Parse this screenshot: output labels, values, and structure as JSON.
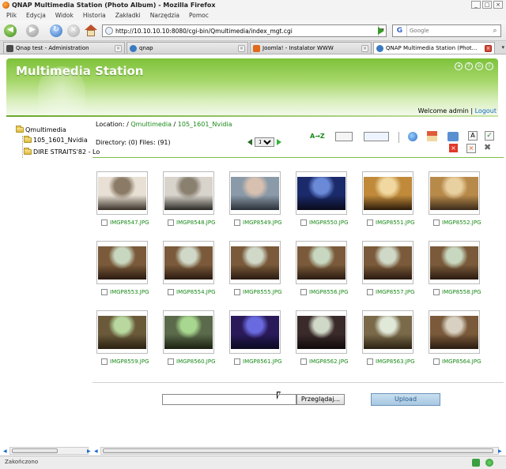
{
  "window": {
    "title": "QNAP Multimedia Station (Photo Album) - Mozilla Firefox",
    "min": "_",
    "max": "□",
    "close": "×"
  },
  "menu": [
    "Plik",
    "Edycja",
    "Widok",
    "Historia",
    "Zakładki",
    "Narzędzia",
    "Pomoc"
  ],
  "navbar": {
    "url": "http://10.10.10.10:8080/cgi-bin/Qmultimedia/index_mgt.cgi",
    "search_placeholder": "Google",
    "search_engine": "G",
    "url_dropdown": "▼"
  },
  "tabs": [
    {
      "label": "Qnap test - Administration",
      "color": "#4a4a4a",
      "active": false
    },
    {
      "label": "qnap",
      "color": "#3a7ac0",
      "active": false
    },
    {
      "label": "Joomla! - Instalator WWW",
      "color": "#e06a1a",
      "active": false
    },
    {
      "label": "QNAP Multimedia Station (Phot...",
      "color": "#3a7ac0",
      "active": true
    }
  ],
  "tab_more": "▾",
  "app": {
    "banner_title": "Multimedia Station",
    "welcome_prefix": "Welcome admin | ",
    "logout": "Logout",
    "tree": {
      "root": "Qmultimedia",
      "children": [
        "105_1601_Nvidia",
        "DIRE STRAITS'82 - Lo"
      ]
    },
    "location_label": "Location:",
    "location_sep": " / ",
    "location_links": [
      "Qmultimedia",
      "105_1601_Nvidia"
    ],
    "directory_text": "Directory: (0) Files: (91)",
    "page": "1",
    "sort_label": "A→Z",
    "photos": [
      {
        "name": "IMGP8547.JPG",
        "palette": [
          "#e8e0d4",
          "#8a7a66",
          "#3a3028"
        ]
      },
      {
        "name": "IMGP8548.JPG",
        "palette": [
          "#d8d4cc",
          "#8a8070",
          "#2a2824"
        ]
      },
      {
        "name": "IMGP8549.JPG",
        "palette": [
          "#8a9aa8",
          "#d8c0b0",
          "#2a3038"
        ]
      },
      {
        "name": "IMGP8550.JPG",
        "palette": [
          "#1a2a6a",
          "#6a8ad8",
          "#0a0a1a"
        ]
      },
      {
        "name": "IMGP8551.JPG",
        "palette": [
          "#c08a3a",
          "#f0d8a0",
          "#2a1a0a"
        ]
      },
      {
        "name": "IMGP8552.JPG",
        "palette": [
          "#b88a4a",
          "#e8d0a0",
          "#3a2a1a"
        ]
      },
      {
        "name": "IMGP8553.JPG",
        "palette": [
          "#7a5a3a",
          "#c8d8c0",
          "#2a1a10"
        ]
      },
      {
        "name": "IMGP8554.JPG",
        "palette": [
          "#7a5a3a",
          "#d0d8c8",
          "#2a1a10"
        ]
      },
      {
        "name": "IMGP8555.JPG",
        "palette": [
          "#7a5a3a",
          "#d0d8c8",
          "#2a1a10"
        ]
      },
      {
        "name": "IMGP8556.JPG",
        "palette": [
          "#7a5a3a",
          "#c8d8c0",
          "#2a1a10"
        ]
      },
      {
        "name": "IMGP8557.JPG",
        "palette": [
          "#7a5a3a",
          "#d0d8c8",
          "#2a1a10"
        ]
      },
      {
        "name": "IMGP8558.JPG",
        "palette": [
          "#7a5a3a",
          "#c8d8c0",
          "#2a1a10"
        ]
      },
      {
        "name": "IMGP8559.JPG",
        "palette": [
          "#6a5a3a",
          "#b8d8a0",
          "#2a2010"
        ]
      },
      {
        "name": "IMGP8560.JPG",
        "palette": [
          "#5a6a4a",
          "#a8d890",
          "#1a2010"
        ]
      },
      {
        "name": "IMGP8561.JPG",
        "palette": [
          "#2a1a5a",
          "#6a6ae0",
          "#0a0a20"
        ]
      },
      {
        "name": "IMGP8562.JPG",
        "palette": [
          "#3a2a2a",
          "#d0d8c8",
          "#100a0a"
        ]
      },
      {
        "name": "IMGP8563.JPG",
        "palette": [
          "#7a6a4a",
          "#e0e8d8",
          "#2a2010"
        ]
      },
      {
        "name": "IMGP8564.JPG",
        "palette": [
          "#7a5a3a",
          "#d8d0c0",
          "#2a1a10"
        ]
      }
    ],
    "browse_label": "Przeglądaj...",
    "upload_label": "Upload"
  },
  "status": {
    "text": "Zakończono"
  },
  "colors": {
    "accent_green": "#1a8a1a",
    "link_blue": "#1a6ad0",
    "banner_green": "#7ec23a"
  }
}
